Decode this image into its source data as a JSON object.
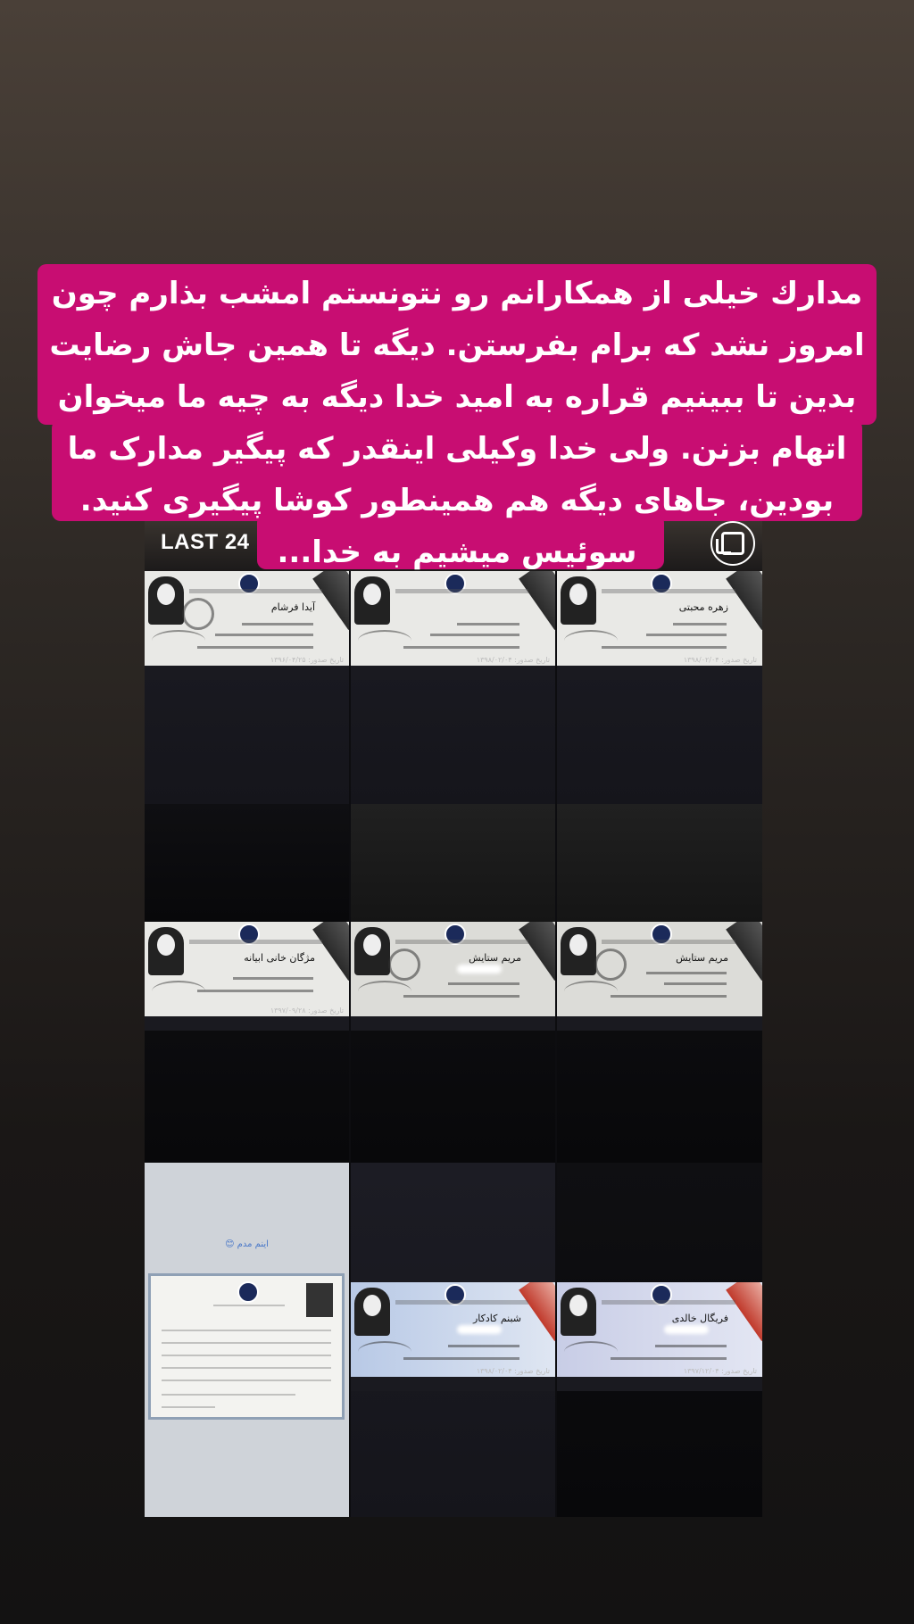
{
  "header": {
    "title": "LAST 24"
  },
  "caption": {
    "lines": [
      "مدارك خیلی از همکارانم رو نتونستم امشب بذارم چون",
      "امروز نشد که برام بفرستن. دیگه تا همین جاش رضایت",
      "بدین تا ببینیم قراره به امید خدا دیگه به چیه ما میخوان",
      "اتهام بزنن. ولی خدا وکیلی اینقدر که پیگیر مدارک ما",
      "بودین، جاهای دیگه هم همینطور کوشا پیگیری کنید.",
      "سوئیس میشیم به خدا..."
    ]
  },
  "cards": [
    {
      "name": "آیدا فرشام",
      "date": "تاریخ صدور: ۱۳۹۶/۰۴/۲۵"
    },
    {
      "name": "",
      "date": "تاریخ صدور: ۱۳۹۸/۰۲/۰۴"
    },
    {
      "name": "زهره محبتی",
      "date": "تاریخ صدور: ۱۳۹۸/۰۲/۰۴"
    },
    {
      "name": "مژگان خانی ابیانه",
      "date": "تاریخ صدور: ۱۳۹۷/۰۹/۲۸"
    },
    {
      "name": "مریم ستایش",
      "date": ""
    },
    {
      "name": "مریم ستایش",
      "date": ""
    },
    {
      "name": "شبنم کادکار",
      "date": "تاریخ صدور: ۱۳۹۸/۰۲/۰۴"
    },
    {
      "name": "فریگال خالدی",
      "date": "تاریخ صدور: ۱۳۹۷/۱۲/۰۴"
    }
  ],
  "certificate": {
    "tag": "اینم مدم 😊"
  },
  "colors": {
    "caption_bg": "#c80d72",
    "text": "#ffffff"
  }
}
